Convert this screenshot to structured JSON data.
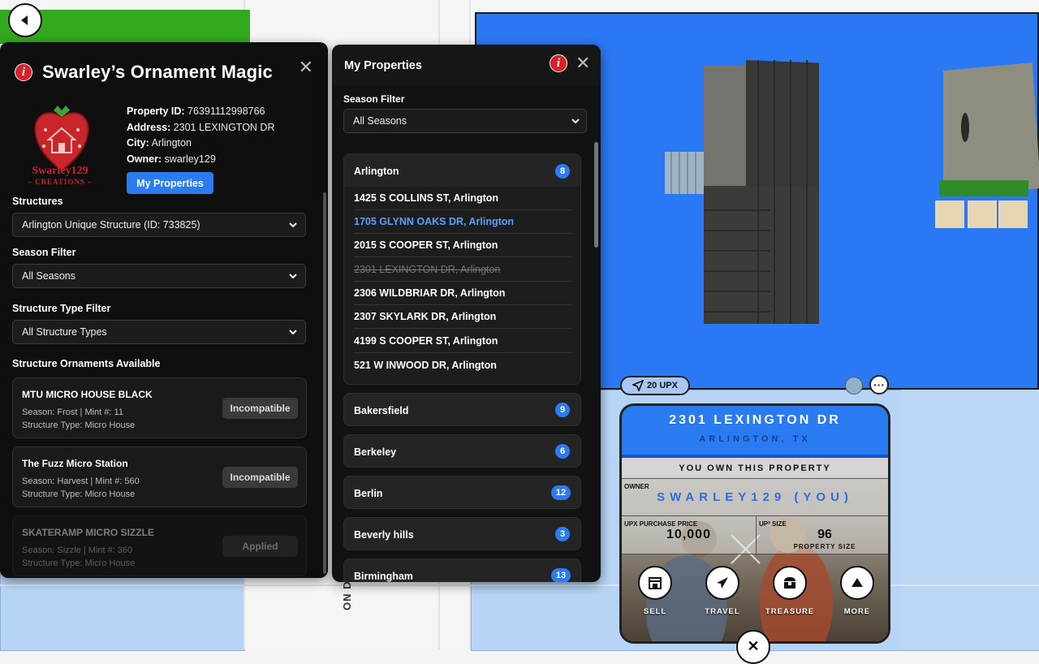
{
  "left_panel": {
    "title": "Swarley’s Ornament Magic",
    "logo_text": "Swarley129",
    "logo_sub": "– CREATIONS –",
    "property": {
      "id_label": "Property ID:",
      "id_value": "76391112998766",
      "address_label": "Address:",
      "address_value": "2301 LEXINGTON DR",
      "city_label": "City:",
      "city_value": "Arlington",
      "owner_label": "Owner:",
      "owner_value": "swarley129"
    },
    "my_properties_button": "My Properties",
    "structures_label": "Structures",
    "structures_value": "Arlington Unique Structure (ID: 733825)",
    "season_filter_label": "Season Filter",
    "season_filter_value": "All Seasons",
    "structure_type_label": "Structure Type Filter",
    "structure_type_value": "All Structure Types",
    "ornaments_label": "Structure Ornaments Available",
    "ornaments": [
      {
        "name": "MTU MICRO HOUSE BLACK",
        "line1": "Season: Frost  |  Mint #: 11",
        "line2": "Structure Type: Micro House",
        "action": "Incompatible"
      },
      {
        "name": "The Fuzz Micro Station",
        "line1": "Season: Harvest  |  Mint #: 560",
        "line2": "Structure Type: Micro House",
        "action": "Incompatible"
      },
      {
        "name": "SKATERAMP MICRO SIZZLE",
        "line1": "Season: Sizzle  |  Mint #: 360",
        "line2": "Structure Type: Micro House",
        "action": "Applied"
      }
    ]
  },
  "right_panel": {
    "title": "My Properties",
    "season_filter_label": "Season Filter",
    "season_filter_value": "All Seasons",
    "open_group": {
      "name": "Arlington",
      "count": "8",
      "items": [
        "1425 S COLLINS ST, Arlington",
        "1705 GLYNN OAKS DR, Arlington",
        "2015 S COOPER ST, Arlington",
        "2301 LEXINGTON DR, Arlington",
        "2306 WILDBRIAR DR, Arlington",
        "2307 SKYLARK DR, Arlington",
        "4199 S COOPER ST, Arlington",
        "521 W INWOOD DR, Arlington"
      ]
    },
    "groups": [
      {
        "name": "Bakersfield",
        "count": "9"
      },
      {
        "name": "Berkeley",
        "count": "6"
      },
      {
        "name": "Berlin",
        "count": "12"
      },
      {
        "name": "Beverly hills",
        "count": "3"
      },
      {
        "name": "Birmingham",
        "count": "13"
      }
    ]
  },
  "map": {
    "street_label": "ON DR",
    "upx_chip": "20 UPX"
  },
  "card": {
    "address": "2301 LEXINGTON DR",
    "city": "ARLINGTON, TX",
    "ownership": "YOU OWN THIS PROPERTY",
    "owner_label": "OWNER",
    "owner_value": "SWARLEY129 (YOU)",
    "price_label": "UPX PURCHASE PRICE",
    "price_value": "10,000",
    "size_label": "UP² SIZE",
    "size_value": "96",
    "size_sub": "PROPERTY SIZE",
    "actions": [
      "SELL",
      "TRAVEL",
      "TREASURE",
      "MORE"
    ]
  },
  "colors": {
    "accent": "#2d7bf2",
    "danger": "#d2232a",
    "parcel": "#2a78f4"
  }
}
